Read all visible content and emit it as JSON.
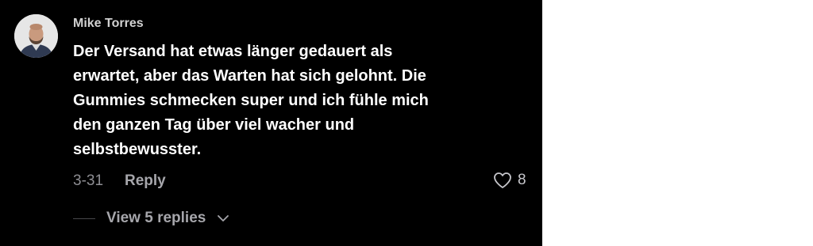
{
  "comment": {
    "author": "Mike Torres",
    "text": "Der Versand hat etwas länger gedauert als erwartet, aber das Warten hat sich gelohnt. Die Gummies schmecken super und ich fühle mich den ganzen Tag über viel wacher und selbstbewusster.",
    "date": "3-31",
    "reply_label": "Reply",
    "like_count": "8",
    "view_replies_label": "View 5 replies"
  },
  "icons": {
    "like": "heart-outline-icon",
    "expand": "chevron-down-icon"
  },
  "colors": {
    "background": "#000000",
    "text_primary": "#ffffff",
    "text_secondary": "#8e8e93"
  }
}
